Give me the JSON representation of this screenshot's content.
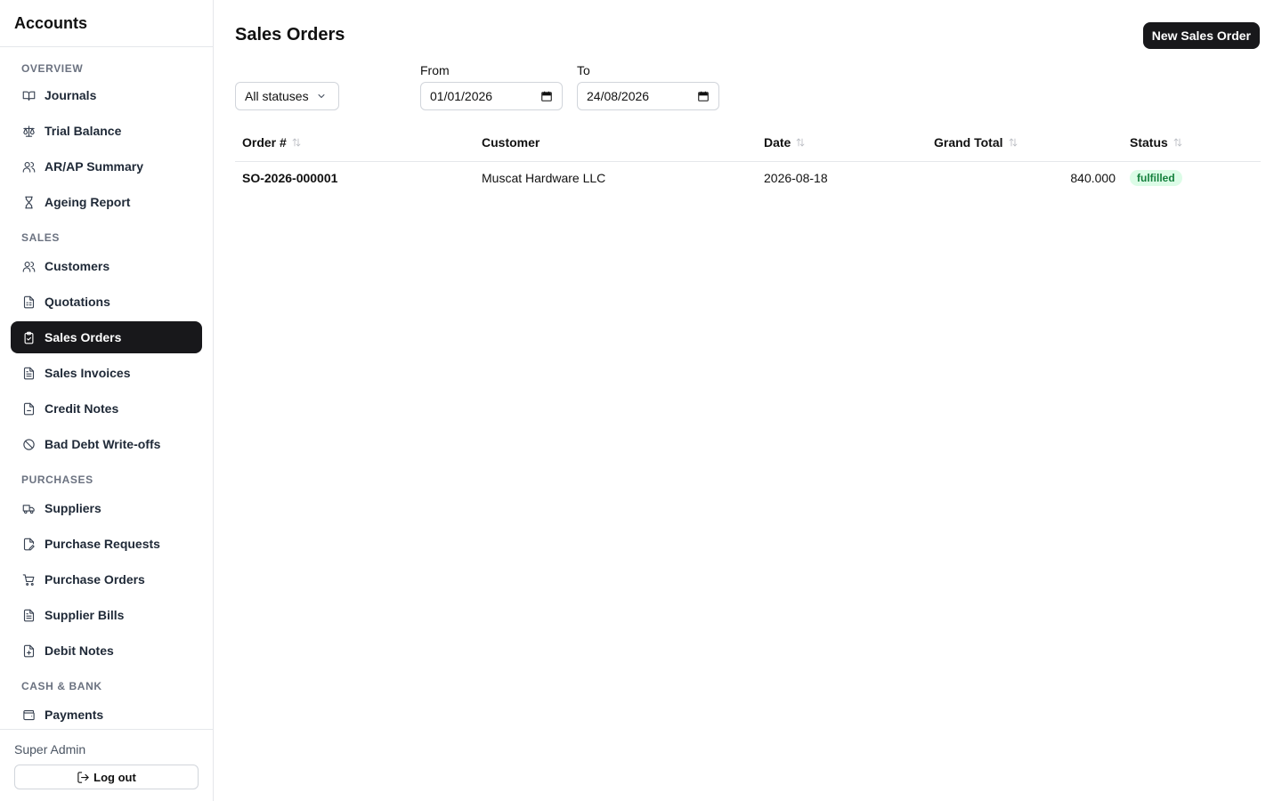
{
  "sidebar": {
    "brand": "Accounts",
    "sections": {
      "overview": "OVERVIEW",
      "sales": "SALES",
      "purchases": "PURCHASES",
      "cash_bank": "CASH & BANK"
    },
    "items": {
      "journals": "Journals",
      "trial_balance": "Trial Balance",
      "arap_summary": "AR/AP Summary",
      "ageing_report": "Ageing Report",
      "customers": "Customers",
      "quotations": "Quotations",
      "sales_orders": "Sales Orders",
      "sales_invoices": "Sales Invoices",
      "credit_notes": "Credit Notes",
      "bad_debt_writeoffs": "Bad Debt Write-offs",
      "suppliers": "Suppliers",
      "purchase_requests": "Purchase Requests",
      "purchase_orders": "Purchase Orders",
      "supplier_bills": "Supplier Bills",
      "debit_notes": "Debit Notes",
      "payments": "Payments"
    },
    "active_item": "Sales Orders",
    "user_name": "Super Admin",
    "logout_label": "Log out"
  },
  "header": {
    "title": "Sales Orders",
    "new_button_label": "New Sales Order"
  },
  "filters": {
    "status_value": "All statuses",
    "from_label": "From",
    "from_value": "01/01/2026",
    "to_label": "To",
    "to_value": "24/08/2026"
  },
  "table": {
    "columns": [
      "Order #",
      "Customer",
      "Date",
      "Grand Total",
      "Status"
    ],
    "rows": [
      {
        "order": "SO-2026-000001",
        "customer": "Muscat Hardware LLC",
        "date": "2026-08-18",
        "grand_total": "840.000",
        "status": "fulfilled"
      }
    ]
  },
  "colors": {
    "accent": "#18181b",
    "status_fulfilled_bg": "#dcfce7",
    "status_fulfilled_text": "#15803d"
  }
}
